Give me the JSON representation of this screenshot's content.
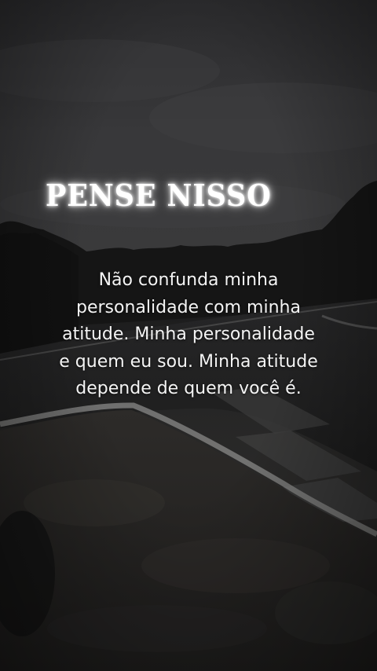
{
  "title": "PENSE NISSO",
  "quote": {
    "lines": [
      "Não confunda minha",
      "personalidade com minha",
      "atitude. Minha personalidade",
      "e quem eu sou. Minha atitude",
      "depende de quem você é."
    ]
  }
}
